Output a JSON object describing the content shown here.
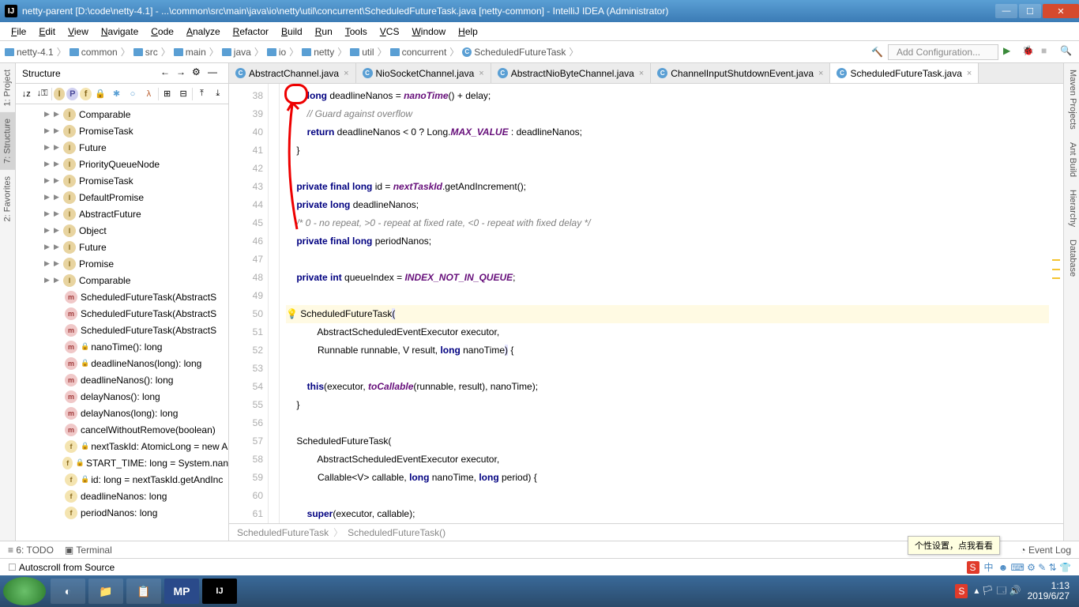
{
  "titlebar": {
    "app_icon_text": "IJ",
    "title": "netty-parent [D:\\code\\netty-4.1] - ...\\common\\src\\main\\java\\io\\netty\\util\\concurrent\\ScheduledFutureTask.java [netty-common] - IntelliJ IDEA (Administrator)"
  },
  "menu": [
    "File",
    "Edit",
    "View",
    "Navigate",
    "Code",
    "Analyze",
    "Refactor",
    "Build",
    "Run",
    "Tools",
    "VCS",
    "Window",
    "Help"
  ],
  "breadcrumbs": [
    {
      "icon": "folder",
      "label": "netty-4.1"
    },
    {
      "icon": "folder",
      "label": "common"
    },
    {
      "icon": "folder",
      "label": "src"
    },
    {
      "icon": "folder",
      "label": "main"
    },
    {
      "icon": "folder",
      "label": "java"
    },
    {
      "icon": "folder",
      "label": "io"
    },
    {
      "icon": "folder",
      "label": "netty"
    },
    {
      "icon": "folder",
      "label": "util"
    },
    {
      "icon": "folder",
      "label": "concurrent"
    },
    {
      "icon": "class",
      "label": "ScheduledFutureTask"
    }
  ],
  "config_placeholder": "Add Configuration...",
  "left_tools": [
    "1: Project",
    "7: Structure",
    "2: Favorites"
  ],
  "right_tools": [
    "Maven Projects",
    "Ant Build",
    "Hierarchy",
    "Database"
  ],
  "structure": {
    "title": "Structure",
    "tree": [
      {
        "d": 2,
        "arr": "▶",
        "arr2": "▶",
        "k": "int",
        "label": "Comparable"
      },
      {
        "d": 2,
        "arr": "▶",
        "arr2": "▶",
        "k": "int",
        "label": "PromiseTask"
      },
      {
        "d": 2,
        "arr": "▶",
        "arr2": "▶",
        "k": "int",
        "label": "Future"
      },
      {
        "d": 2,
        "arr": "▶",
        "arr2": "▶",
        "k": "int",
        "label": "PriorityQueueNode"
      },
      {
        "d": 2,
        "arr": "▶",
        "arr2": "▶",
        "k": "int",
        "label": "PromiseTask"
      },
      {
        "d": 2,
        "arr": "▶",
        "arr2": "▶",
        "k": "int",
        "label": "DefaultPromise"
      },
      {
        "d": 2,
        "arr": "▶",
        "arr2": "▶",
        "k": "int",
        "label": "AbstractFuture"
      },
      {
        "d": 2,
        "arr": "▶",
        "arr2": "▶",
        "k": "int",
        "label": "Object"
      },
      {
        "d": 2,
        "arr": "▶",
        "arr2": "▶",
        "k": "int",
        "label": "Future"
      },
      {
        "d": 2,
        "arr": "▶",
        "arr2": "▶",
        "k": "int",
        "label": "Promise"
      },
      {
        "d": 2,
        "arr": "▶",
        "arr2": "▶",
        "k": "int",
        "label": "Comparable"
      },
      {
        "d": 3,
        "k": "m",
        "label": "ScheduledFutureTask(AbstractS"
      },
      {
        "d": 3,
        "k": "m",
        "label": "ScheduledFutureTask(AbstractS"
      },
      {
        "d": 3,
        "k": "m",
        "label": "ScheduledFutureTask(AbstractS"
      },
      {
        "d": 3,
        "k": "m",
        "lock": true,
        "label": "nanoTime(): long"
      },
      {
        "d": 3,
        "k": "m",
        "lock": true,
        "label": "deadlineNanos(long): long"
      },
      {
        "d": 3,
        "k": "m",
        "label": "deadlineNanos(): long"
      },
      {
        "d": 3,
        "k": "m",
        "label": "delayNanos(): long"
      },
      {
        "d": 3,
        "k": "m",
        "label": "delayNanos(long): long"
      },
      {
        "d": 3,
        "k": "m",
        "label": "cancelWithoutRemove(boolean)"
      },
      {
        "d": 3,
        "k": "f",
        "lock": true,
        "label": "nextTaskId: AtomicLong = new A"
      },
      {
        "d": 3,
        "k": "f",
        "lock": true,
        "label": "START_TIME: long = System.nan"
      },
      {
        "d": 3,
        "k": "f",
        "lock": true,
        "label": "id: long = nextTaskId.getAndInc"
      },
      {
        "d": 3,
        "k": "f",
        "label": "deadlineNanos: long"
      },
      {
        "d": 3,
        "k": "f",
        "label": "periodNanos: long"
      }
    ]
  },
  "tabs": [
    {
      "label": "AbstractChannel.java",
      "active": false
    },
    {
      "label": "NioSocketChannel.java",
      "active": false
    },
    {
      "label": "AbstractNioByteChannel.java",
      "active": false
    },
    {
      "label": "ChannelInputShutdownEvent.java",
      "active": false
    },
    {
      "label": "ScheduledFutureTask.java",
      "active": true
    }
  ],
  "editor": {
    "first_line": 38,
    "lines": [
      "        <k>long</k> deadlineNanos = <s>nanoTime</s>() + delay;",
      "        <c>// Guard against overflow</c>",
      "        <k>return</k> deadlineNanos &lt; 0 ? Long.<s>MAX_VALUE</s> : deadlineNanos;",
      "    }",
      "",
      "    <k>private final long</k> id = <s>nextTaskId</s>.getAndIncrement();",
      "    <k>private long</k> deadlineNanos;",
      "    <c>/* 0 - no repeat, &gt;0 - repeat at fixed rate, &lt;0 - repeat with fixed delay */</c>",
      "    <k>private final long</k> periodNanos;",
      "",
      "    <k>private int</k> queueIndex = <s>INDEX_NOT_IN_QUEUE</s>;",
      "",
      "<bulb>💡</bulb> ScheduledFutureTask<hl>(</hl>",
      "            AbstractScheduledEventExecutor executor,",
      "            Runnable runnable, V result, <k>long</k> nanoTime<hl>)</hl> {",
      "",
      "        <k>this</k>(executor, <s>toCallable</s>(runnable, result), nanoTime);",
      "    }",
      "",
      "    ScheduledFutureTask(",
      "            AbstractScheduledEventExecutor executor,",
      "            Callable&lt;V&gt; callable, <k>long</k> nanoTime, <k>long</k> period) {",
      "",
      "        <k>super</k>(executor, callable);"
    ],
    "caret_line_index": 12
  },
  "editor_crumb": [
    "ScheduledFutureTask",
    "ScheduledFutureTask()"
  ],
  "bottom_tools": [
    "6: TODO",
    "Terminal"
  ],
  "event_log": "Event Log",
  "status_text": "Autoscroll from Source",
  "tooltip": "个性设置，点我看看",
  "tray": {
    "time": "1:13",
    "date": "2019/6/27",
    "ime": "中"
  }
}
